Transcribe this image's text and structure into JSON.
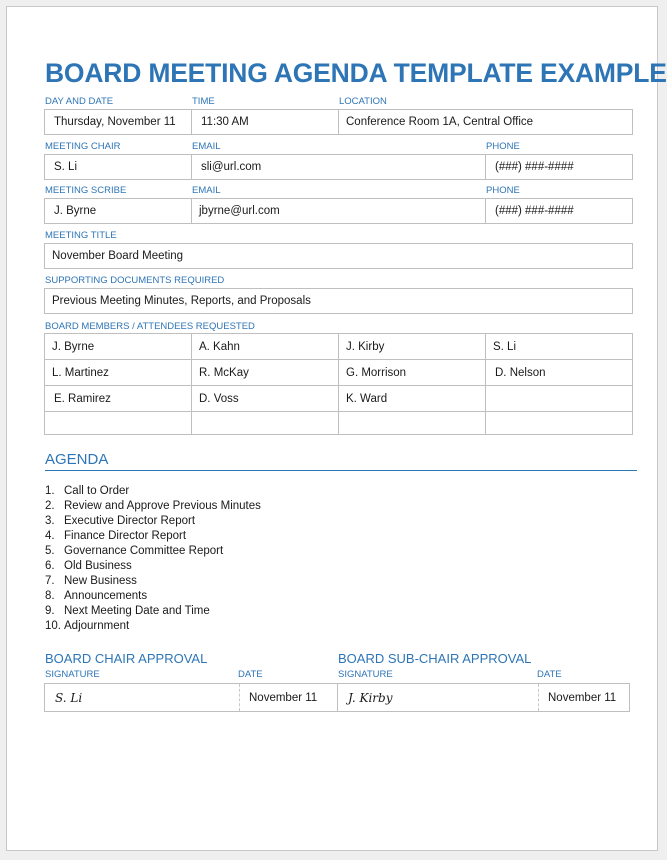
{
  "document": {
    "title": "BOARD MEETING AGENDA TEMPLATE EXAMPLE",
    "accent_color": "#2e75b6"
  },
  "meeting_info": {
    "labels": {
      "day_and_date": "DAY AND DATE",
      "time": "TIME",
      "location": "LOCATION"
    },
    "day_and_date": "Thursday, November 11",
    "time": "11:30 AM",
    "location": "Conference Room 1A, Central Office"
  },
  "chair": {
    "labels": {
      "name": "MEETING CHAIR",
      "email": "EMAIL",
      "phone": "PHONE"
    },
    "name": "S. Li",
    "email": "sli@url.com",
    "phone": "(###) ###-####"
  },
  "scribe": {
    "labels": {
      "name": "MEETING SCRIBE",
      "email": "EMAIL",
      "phone": "PHONE"
    },
    "name": "J. Byrne",
    "email": "jbyrne@url.com",
    "phone": "(###) ###-####"
  },
  "meeting_title": {
    "label": "MEETING TITLE",
    "value": "November Board Meeting"
  },
  "supporting_documents": {
    "label": "SUPPORTING DOCUMENTS REQUIRED",
    "value": "Previous Meeting Minutes, Reports, and Proposals"
  },
  "attendees": {
    "label": "BOARD MEMBERS / ATTENDEES REQUESTED",
    "rows": [
      [
        "J. Byrne",
        "A. Kahn",
        "J. Kirby",
        "S. Li"
      ],
      [
        "L. Martinez",
        "R. McKay",
        "G. Morrison",
        "D. Nelson"
      ],
      [
        "E. Ramirez",
        "D. Voss",
        "K. Ward",
        ""
      ],
      [
        "",
        "",
        "",
        ""
      ]
    ]
  },
  "agenda": {
    "heading": "AGENDA",
    "items": [
      {
        "num": "1.",
        "text": "Call to Order"
      },
      {
        "num": "2.",
        "text": "Review and Approve Previous Minutes"
      },
      {
        "num": "3.",
        "text": "Executive Director Report"
      },
      {
        "num": "4.",
        "text": "Finance Director Report"
      },
      {
        "num": "5.",
        "text": "Governance Committee Report"
      },
      {
        "num": "6.",
        "text": "Old Business"
      },
      {
        "num": "7.",
        "text": "New Business"
      },
      {
        "num": "8.",
        "text": "Announcements"
      },
      {
        "num": "9.",
        "text": "Next Meeting Date and Time"
      },
      {
        "num": "10.",
        "text": "Adjournment"
      }
    ]
  },
  "approvals": {
    "chair": {
      "heading": "BOARD CHAIR APPROVAL",
      "signature_label": "SIGNATURE",
      "date_label": "DATE",
      "signature": "S. Li",
      "date": "November 11"
    },
    "sub_chair": {
      "heading": "BOARD SUB-CHAIR APPROVAL",
      "signature_label": "SIGNATURE",
      "date_label": "DATE",
      "signature": "J. Kirby",
      "date": "November 11"
    }
  }
}
